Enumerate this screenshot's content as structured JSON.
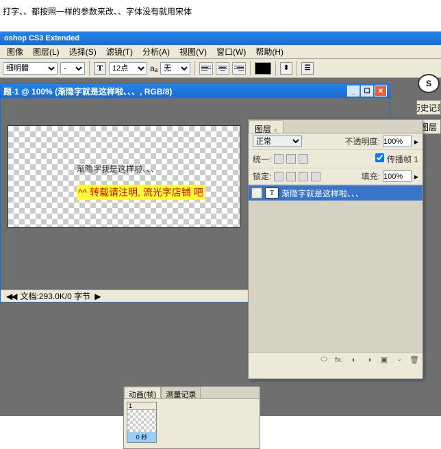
{
  "annotation": "打字、、都按照一样的参数来改、、字体没有就用宋体",
  "app_title": "oshop CS3 Extended",
  "menu": [
    "图像",
    "图层(L)",
    "选择(S)",
    "滤镜(T)",
    "分析(A)",
    "视图(V)",
    "窗口(W)",
    "帮助(H)"
  ],
  "options": {
    "font_family": "细明體",
    "font_style": "-",
    "font_size": "12点",
    "aa_label": "aₐ",
    "aa_mode": "无"
  },
  "doc": {
    "title": "题-1 @ 100% (渐隐字就是这样啦、、、, RGB/8)",
    "canvas_text": "渐隐字我是这样啦、、、",
    "watermark": "^^ 转载请注明, 流光字店铺  吧",
    "status": "文档:293.0K/0 字节"
  },
  "layers_panel": {
    "tab": "图层",
    "blend": "正常",
    "opacity_label": "不透明度:",
    "opacity": "100%",
    "unify_label": "统一:",
    "propagate": "传播帧 1",
    "lock_label": "锁定:",
    "fill_label": "填充:",
    "fill": "100%",
    "layer_name": "渐隐字就是这样啦、、、"
  },
  "side": {
    "history": "历史记录",
    "layers": "图层"
  },
  "anim": {
    "tab1": "动画(帧)",
    "tab2": "测量记录",
    "frame_num": "1",
    "frame_time": "0 秒"
  }
}
